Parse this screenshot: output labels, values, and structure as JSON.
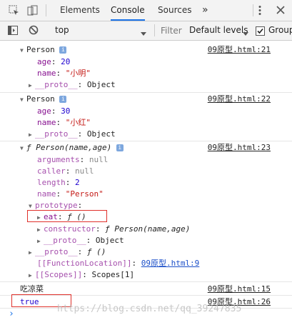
{
  "tabs": {
    "elements": "Elements",
    "console": "Console",
    "sources": "Sources",
    "more": "»"
  },
  "toolbar": {
    "context": "top",
    "filter_placeholder": "Filter",
    "levels": "Default levels",
    "group_label": "Group"
  },
  "colors": {
    "accent": "#1a73e8",
    "highlight_border": "#e0302a"
  },
  "console": {
    "p1": {
      "title": "Person",
      "age_key": "age",
      "age_val": "20",
      "name_key": "name",
      "name_val": "\"小明\"",
      "proto_key": "__proto__",
      "proto_val": "Object",
      "link": "09原型.html:21"
    },
    "p2": {
      "title": "Person",
      "age_key": "age",
      "age_val": "30",
      "name_key": "name",
      "name_val": "\"小红\"",
      "proto_key": "__proto__",
      "proto_val": "Object",
      "link": "09原型.html:22"
    },
    "fn": {
      "title": "ƒ Person(name,age)",
      "link": "09原型.html:23",
      "arguments_key": "arguments",
      "arguments_val": "null",
      "caller_key": "caller",
      "caller_val": "null",
      "length_key": "length",
      "length_val": "2",
      "name_key": "name",
      "name_val": "\"Person\"",
      "prototype_key": "prototype",
      "eat_key": "eat",
      "eat_val": "ƒ ()",
      "ctor_key": "constructor",
      "ctor_val": "ƒ Person(name,age)",
      "pproto_key": "__proto__",
      "pproto_val": "Object",
      "fproto_key": "__proto__",
      "fproto_val": "ƒ ()",
      "floc_key": "[[FunctionLocation]]",
      "floc_val": "09原型.html:9",
      "scopes_key": "[[Scopes]]",
      "scopes_val": "Scopes[1]"
    },
    "log1": {
      "text": "吃凉菜",
      "link": "09原型.html:15"
    },
    "log2": {
      "text": "true",
      "link": "09原型.html:26"
    }
  },
  "watermark": "https://blog.csdn.net/qq_39247835"
}
